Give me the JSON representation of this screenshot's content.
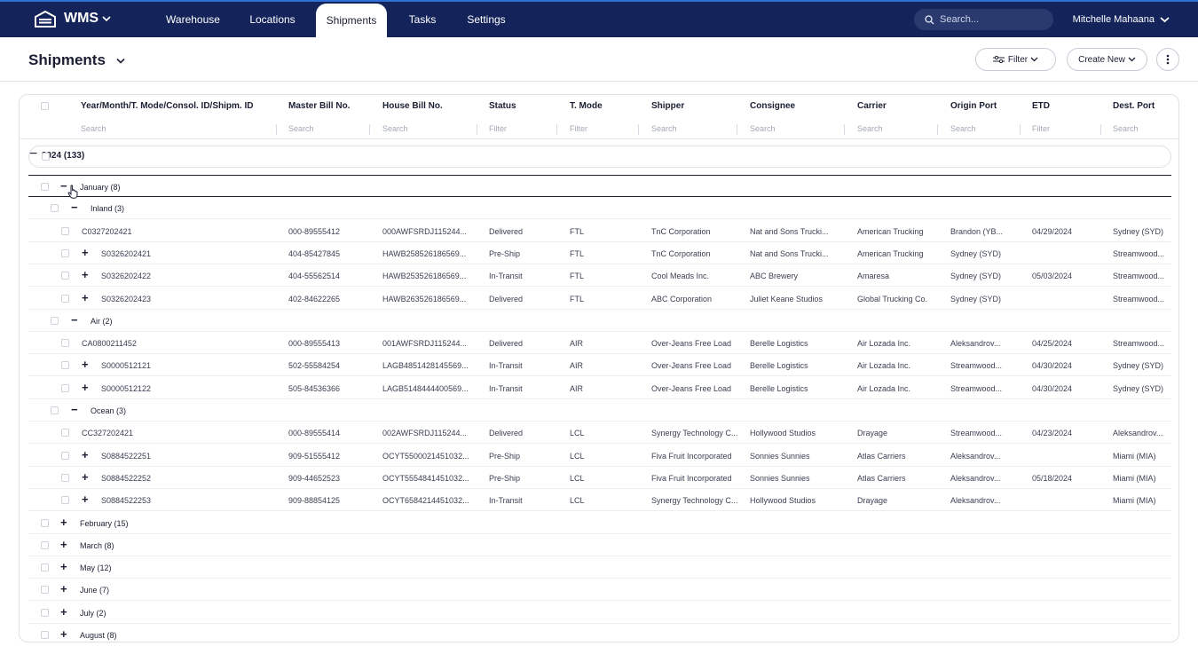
{
  "app": {
    "brand": "WMS",
    "nav": [
      "Warehouse",
      "Locations",
      "Shipments",
      "Tasks",
      "Settings"
    ],
    "active_nav": "Shipments",
    "search_placeholder": "Search...",
    "user": "Mitchelle Mahaana"
  },
  "page": {
    "title": "Shipments",
    "filter_label": "Filter",
    "create_label": "Create New"
  },
  "table": {
    "columns": [
      "Year/Month/T. Mode/Consol. ID/Shipm. ID",
      "Master Bill No.",
      "House Bill No.",
      "Status",
      "T. Mode",
      "Shipper",
      "Consignee",
      "Carrier",
      "Origin Port",
      "ETD",
      "Dest. Port"
    ],
    "filters": [
      "Search",
      "Search",
      "Search",
      "Filter",
      "Filter",
      "Search",
      "Search",
      "Search",
      "Search",
      "Filter",
      "Search"
    ],
    "year_group": "2024 (133)",
    "open_month": "January (8)",
    "modes": [
      {
        "label": "Inland (3)",
        "rows": [
          {
            "id": "C0327202421",
            "expand": false,
            "mbl": "000-89555412",
            "hbl": "000AWFSRDJ115244...",
            "status": "Delivered",
            "mode": "FTL",
            "shipper": "TnC Corporation",
            "consignee": "Nat and Sons Trucki...",
            "carrier": "American Trucking",
            "origin": "Brandon (YB...",
            "etd": "04/29/2024",
            "dest": "Sydney (SYD)"
          },
          {
            "id": "S0326202421",
            "expand": true,
            "mbl": "404-85427845",
            "hbl": "HAWB258526186569...",
            "status": "Pre-Ship",
            "mode": "FTL",
            "shipper": "TnC Corporation",
            "consignee": "Nat and Sons Trucki...",
            "carrier": "American Trucking",
            "origin": "Sydney (SYD)",
            "etd": "",
            "dest": "Streamwood..."
          },
          {
            "id": "S0326202422",
            "expand": true,
            "mbl": "404-55562514",
            "hbl": "HAWB253526186569...",
            "status": "In-Transit",
            "mode": "FTL",
            "shipper": "Cool Meads Inc.",
            "consignee": "ABC Brewery",
            "carrier": "Amaresa",
            "origin": "Sydney (SYD)",
            "etd": "05/03/2024",
            "dest": "Streamwood..."
          },
          {
            "id": "S0326202423",
            "expand": true,
            "mbl": "402-84622265",
            "hbl": "HAWB263526186569...",
            "status": "Delivered",
            "mode": "FTL",
            "shipper": "ABC Corporation",
            "consignee": "Juliet Keane Studios",
            "carrier": "Global Trucking Co.",
            "origin": "Sydney (SYD)",
            "etd": "",
            "dest": "Streamwood..."
          }
        ]
      },
      {
        "label": "Air (2)",
        "rows": [
          {
            "id": "CA0800211452",
            "expand": false,
            "mbl": "000-89555413",
            "hbl": "001AWFSRDJ115244...",
            "status": "Delivered",
            "mode": "AIR",
            "shipper": "Over-Jeans Free Load",
            "consignee": "Berelle Logistics",
            "carrier": "Air Lozada Inc.",
            "origin": "Aleksandrov...",
            "etd": "04/25/2024",
            "dest": "Streamwood..."
          },
          {
            "id": "S0000512121",
            "expand": true,
            "mbl": "502-55584254",
            "hbl": "LAGB4851428145569...",
            "status": "In-Transit",
            "mode": "AIR",
            "shipper": "Over-Jeans Free Load",
            "consignee": "Berelle Logistics",
            "carrier": "Air Lozada Inc.",
            "origin": "Streamwood...",
            "etd": "04/30/2024",
            "dest": "Sydney (SYD)"
          },
          {
            "id": "S0000512122",
            "expand": true,
            "mbl": "505-84536366",
            "hbl": "LAGB5148444400569...",
            "status": "In-Transit",
            "mode": "AIR",
            "shipper": "Over-Jeans Free Load",
            "consignee": "Berelle Logistics",
            "carrier": "Air Lozada Inc.",
            "origin": "Streamwood...",
            "etd": "04/30/2024",
            "dest": "Sydney (SYD)"
          }
        ]
      },
      {
        "label": "Ocean (3)",
        "rows": [
          {
            "id": "CC327202421",
            "expand": false,
            "mbl": "000-89555414",
            "hbl": "002AWFSRDJ115244...",
            "status": "Delivered",
            "mode": "LCL",
            "shipper": "Synergy Technology C...",
            "consignee": "Hollywood Studios",
            "carrier": "Drayage",
            "origin": "Streamwood...",
            "etd": "04/23/2024",
            "dest": "Aleksandrov..."
          },
          {
            "id": "S0884522251",
            "expand": true,
            "mbl": "909-51555412",
            "hbl": "OCYT5500021451032...",
            "status": "Pre-Ship",
            "mode": "LCL",
            "shipper": "Fiva Fruit Incorporated",
            "consignee": "Sonnies Sunnies",
            "carrier": "Atlas Carriers",
            "origin": "Aleksandrov...",
            "etd": "",
            "dest": "Miami (MIA)"
          },
          {
            "id": "S0884522252",
            "expand": true,
            "mbl": "909-44652523",
            "hbl": "OCYT5554841451032...",
            "status": "Pre-Ship",
            "mode": "LCL",
            "shipper": "Fiva Fruit Incorporated",
            "consignee": "Sonnies Sunnies",
            "carrier": "Atlas Carriers",
            "origin": "Aleksandrov...",
            "etd": "05/18/2024",
            "dest": "Miami (MIA)"
          },
          {
            "id": "S0884522253",
            "expand": true,
            "mbl": "909-88854125",
            "hbl": "OCYT6584214451032...",
            "status": "In-Transit",
            "mode": "LCL",
            "shipper": "Synergy Technology C...",
            "consignee": "Hollywood Studios",
            "carrier": "Drayage",
            "origin": "Aleksandrov...",
            "etd": "",
            "dest": "Miami (MIA)"
          }
        ]
      }
    ],
    "collapsed_months": [
      "February (15)",
      "March (8)",
      "May (12)",
      "June (7)",
      "July (2)",
      "August (8)"
    ]
  }
}
